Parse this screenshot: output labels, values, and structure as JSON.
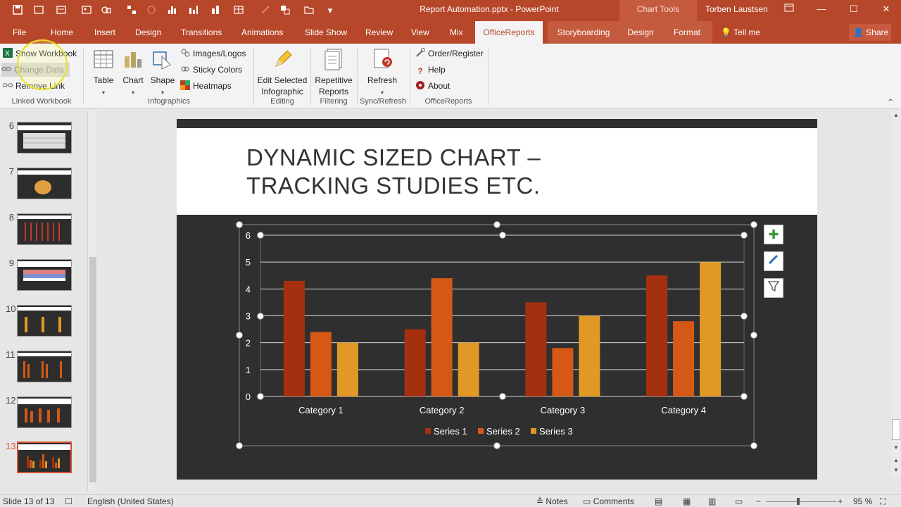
{
  "window": {
    "title": "Report Automation.pptx - PowerPoint",
    "context_tab": "Chart Tools",
    "user": "Torben Laustsen",
    "accent": "#b7472a"
  },
  "tabs": [
    {
      "label": "File"
    },
    {
      "label": "Home"
    },
    {
      "label": "Insert"
    },
    {
      "label": "Design"
    },
    {
      "label": "Transitions"
    },
    {
      "label": "Animations"
    },
    {
      "label": "Slide Show"
    },
    {
      "label": "Review"
    },
    {
      "label": "View"
    },
    {
      "label": "Mix"
    },
    {
      "label": "OfficeReports"
    },
    {
      "label": "Storyboarding"
    },
    {
      "label": "Design"
    },
    {
      "label": "Format"
    },
    {
      "label": "Tell me"
    }
  ],
  "share_label": "Share",
  "ribbon": {
    "linked_workbook": {
      "show_workbook": "Show Workbook",
      "change_data": "Change Data",
      "remove_link": "Remove Link",
      "group": "Linked Workbook"
    },
    "infographics": {
      "table": "Table",
      "chart": "Chart",
      "shape": "Shape",
      "images_logos": "Images/Logos",
      "sticky_colors": "Sticky Colors",
      "heatmaps": "Heatmaps",
      "group": "Infographics"
    },
    "editing": {
      "edit_selected_line1": "Edit Selected",
      "edit_selected_line2": "Infographic",
      "group": "Editing"
    },
    "filtering": {
      "repetitive_line1": "Repetitive",
      "repetitive_line2": "Reports",
      "group": "Filtering"
    },
    "sync": {
      "refresh": "Refresh",
      "group": "Sync/Refresh"
    },
    "officereports": {
      "order_register": "Order/Register",
      "help": "Help",
      "about": "About",
      "group": "OfficeReports"
    }
  },
  "thumbnails": [
    {
      "num": "6"
    },
    {
      "num": "7"
    },
    {
      "num": "8"
    },
    {
      "num": "9"
    },
    {
      "num": "10"
    },
    {
      "num": "11"
    },
    {
      "num": "12"
    },
    {
      "num": "13"
    }
  ],
  "slide": {
    "title_line1": "DYNAMIC  SIZED CHART –",
    "title_line2": "TRACKING STUDIES ETC."
  },
  "chart_data": {
    "type": "bar",
    "categories": [
      "Category 1",
      "Category 2",
      "Category 3",
      "Category 4"
    ],
    "series": [
      {
        "name": "Series 1",
        "values": [
          4.3,
          2.5,
          3.5,
          4.5
        ],
        "color": "#a5300f"
      },
      {
        "name": "Series 2",
        "values": [
          2.4,
          4.4,
          1.8,
          2.8
        ],
        "color": "#d55816"
      },
      {
        "name": "Series 3",
        "values": [
          2.0,
          2.0,
          3.0,
          5.0
        ],
        "color": "#e19825"
      }
    ],
    "ylim": [
      0,
      6
    ],
    "yticks": [
      "0",
      "1",
      "2",
      "3",
      "4",
      "5",
      "6"
    ],
    "grid": true,
    "legend": "bottom"
  },
  "status": {
    "slide_info": "Slide 13 of 13",
    "language": "English (United States)",
    "notes": "Notes",
    "comments": "Comments",
    "zoom": "95 %"
  }
}
